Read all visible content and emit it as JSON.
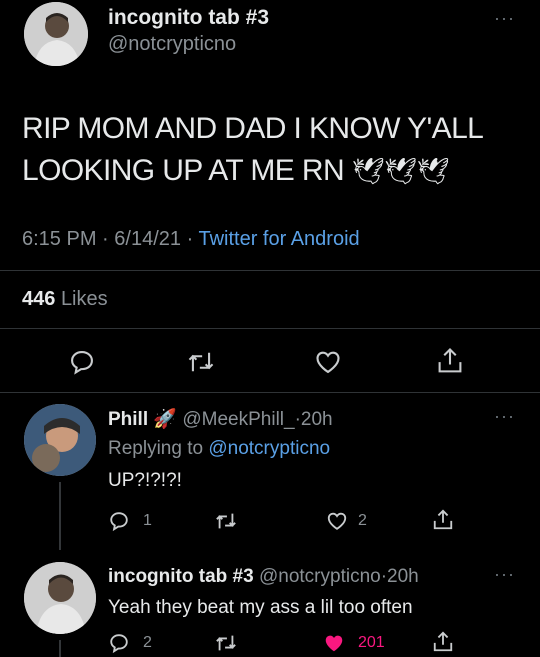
{
  "main_tweet": {
    "display_name": "incognito tab #3",
    "handle": "@notcrypticno",
    "text_line1": "RIP MOM AND DAD I KNOW Y'ALL",
    "text_line2": "LOOKING UP AT ME RN",
    "emoji": "🕊🕊🕊",
    "time": "6:15 PM",
    "date": "6/14/21",
    "sep": "·",
    "client": "Twitter for Android",
    "likes_count": "446",
    "likes_label": "Likes"
  },
  "reply1": {
    "display_name": "Phill",
    "emoji": "🚀",
    "handle": "@MeekPhill_",
    "sep": "·",
    "age": "20h",
    "replying_prefix": "Replying to",
    "replying_handle": "@notcrypticno",
    "text": "UP?!?!?!",
    "reply_count": "1",
    "like_count": "2"
  },
  "reply2": {
    "display_name": "incognito tab #3",
    "handle": "@notcrypticno",
    "sep": "·",
    "age": "20h",
    "text": "Yeah they beat my ass a lil too often",
    "reply_count": "2",
    "like_count": "201",
    "liked": true
  },
  "colors": {
    "background": "#000000",
    "link": "#5aa0e6",
    "like_active": "#f91880"
  },
  "icons": [
    "more-icon",
    "reply-icon",
    "retweet-icon",
    "like-icon",
    "share-icon"
  ]
}
